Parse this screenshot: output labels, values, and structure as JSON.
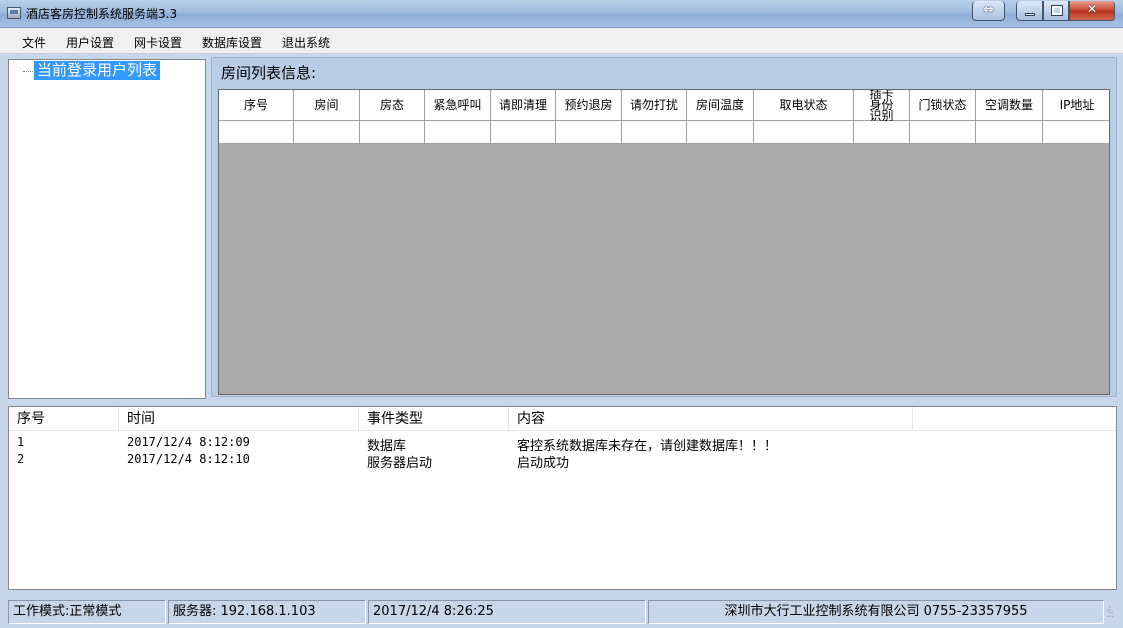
{
  "window": {
    "title": "酒店客房控制系统服务端3.3"
  },
  "menu": {
    "items": [
      {
        "label": "文件"
      },
      {
        "label": "用户设置"
      },
      {
        "label": "网卡设置"
      },
      {
        "label": "数据库设置"
      },
      {
        "label": "退出系统"
      }
    ]
  },
  "tree": {
    "root_label": "当前登录用户列表"
  },
  "rooms": {
    "title": "房间列表信息:",
    "columns": [
      "序号",
      "房间",
      "房态",
      "紧急呼叫",
      "请即清理",
      "预约退房",
      "请勿打扰",
      "房间温度",
      "取电状态",
      "插卡身份识别",
      "门锁状态",
      "空调数量",
      "IP地址"
    ]
  },
  "log": {
    "columns": [
      "序号",
      "时间",
      "事件类型",
      "内容"
    ],
    "rows": [
      {
        "no": "1",
        "time": "2017/12/4 8:12:09",
        "type": "数据库",
        "content": "客控系统数据库未存在，请创建数据库！！！"
      },
      {
        "no": "2",
        "time": "2017/12/4 8:12:10",
        "type": "服务器启动",
        "content": "启动成功"
      }
    ]
  },
  "status": {
    "mode": "工作模式:正常模式",
    "server": "服务器: 192.168.1.103",
    "datetime": "2017/12/4 8:26:25",
    "company": "深圳市大行工业控制系统有限公司 0755-23357955"
  },
  "colors": {
    "selection": "#3399ff",
    "grid_background": "#ababab",
    "close_button": "#c7432c"
  }
}
